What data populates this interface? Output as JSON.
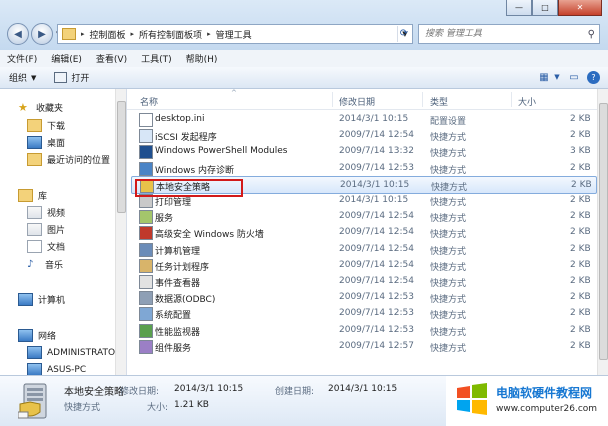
{
  "window": {
    "controls": {
      "min": "—",
      "max": "□",
      "close": "✕"
    },
    "breadcrumb": [
      "控制面板",
      "所有控制面板项",
      "管理工具"
    ],
    "search_placeholder": "搜索 管理工具"
  },
  "menu": [
    "文件(F)",
    "编辑(E)",
    "查看(V)",
    "工具(T)",
    "帮助(H)"
  ],
  "toolbar": {
    "organize": "组织",
    "open": "打开"
  },
  "nav": {
    "favorites": "收藏夹",
    "fav_items": [
      "下载",
      "桌面",
      "最近访问的位置"
    ],
    "libraries": "库",
    "lib_items": [
      "视频",
      "图片",
      "文档",
      "音乐"
    ],
    "computer": "计算机",
    "network": "网络",
    "net_items": [
      "ADMINISTRATO",
      "ASUS-PC"
    ]
  },
  "columns": {
    "name": "名称",
    "date": "修改日期",
    "type": "类型",
    "size": "大小"
  },
  "files": [
    {
      "name": "desktop.ini",
      "date": "2014/3/1 10:15",
      "type": "配置设置",
      "size": "2 KB",
      "icon": "ini-file-icon"
    },
    {
      "name": "iSCSI 发起程序",
      "date": "2009/7/14 12:54",
      "type": "快捷方式",
      "size": "2 KB",
      "icon": "iscsi-icon"
    },
    {
      "name": "Windows PowerShell Modules",
      "date": "2009/7/14 13:32",
      "type": "快捷方式",
      "size": "3 KB",
      "icon": "powershell-icon"
    },
    {
      "name": "Windows 内存诊断",
      "date": "2009/7/14 12:53",
      "type": "快捷方式",
      "size": "2 KB",
      "icon": "memory-diagnostic-icon"
    },
    {
      "name": "本地安全策略",
      "date": "2014/3/1 10:15",
      "type": "快捷方式",
      "size": "2 KB",
      "icon": "security-policy-icon"
    },
    {
      "name": "打印管理",
      "date": "2014/3/1 10:15",
      "type": "快捷方式",
      "size": "2 KB",
      "icon": "print-management-icon"
    },
    {
      "name": "服务",
      "date": "2009/7/14 12:54",
      "type": "快捷方式",
      "size": "2 KB",
      "icon": "services-icon"
    },
    {
      "name": "高级安全 Windows 防火墙",
      "date": "2009/7/14 12:54",
      "type": "快捷方式",
      "size": "2 KB",
      "icon": "firewall-icon"
    },
    {
      "name": "计算机管理",
      "date": "2009/7/14 12:54",
      "type": "快捷方式",
      "size": "2 KB",
      "icon": "computer-management-icon"
    },
    {
      "name": "任务计划程序",
      "date": "2009/7/14 12:54",
      "type": "快捷方式",
      "size": "2 KB",
      "icon": "task-scheduler-icon"
    },
    {
      "name": "事件查看器",
      "date": "2009/7/14 12:54",
      "type": "快捷方式",
      "size": "2 KB",
      "icon": "event-viewer-icon"
    },
    {
      "name": "数据源(ODBC)",
      "date": "2009/7/14 12:53",
      "type": "快捷方式",
      "size": "2 KB",
      "icon": "odbc-icon"
    },
    {
      "name": "系统配置",
      "date": "2009/7/14 12:53",
      "type": "快捷方式",
      "size": "2 KB",
      "icon": "system-config-icon"
    },
    {
      "name": "性能监视器",
      "date": "2009/7/14 12:53",
      "type": "快捷方式",
      "size": "2 KB",
      "icon": "performance-monitor-icon"
    },
    {
      "name": "组件服务",
      "date": "2009/7/14 12:57",
      "type": "快捷方式",
      "size": "2 KB",
      "icon": "component-services-icon"
    }
  ],
  "selected_index": 4,
  "details": {
    "name": "本地安全策略",
    "modified_label": "修改日期:",
    "modified": "2014/3/1 10:15",
    "created_label": "创建日期:",
    "created": "2014/3/1 10:15",
    "type": "快捷方式",
    "size_label": "大小:",
    "size": "1.21 KB"
  },
  "watermark": {
    "title": "电脑软硬件教程网",
    "url": "www.computer26.com"
  },
  "colors": {
    "selection_border": "#84acdd",
    "highlight_box": "#d21a1a",
    "brand_blue": "#1677d2"
  }
}
